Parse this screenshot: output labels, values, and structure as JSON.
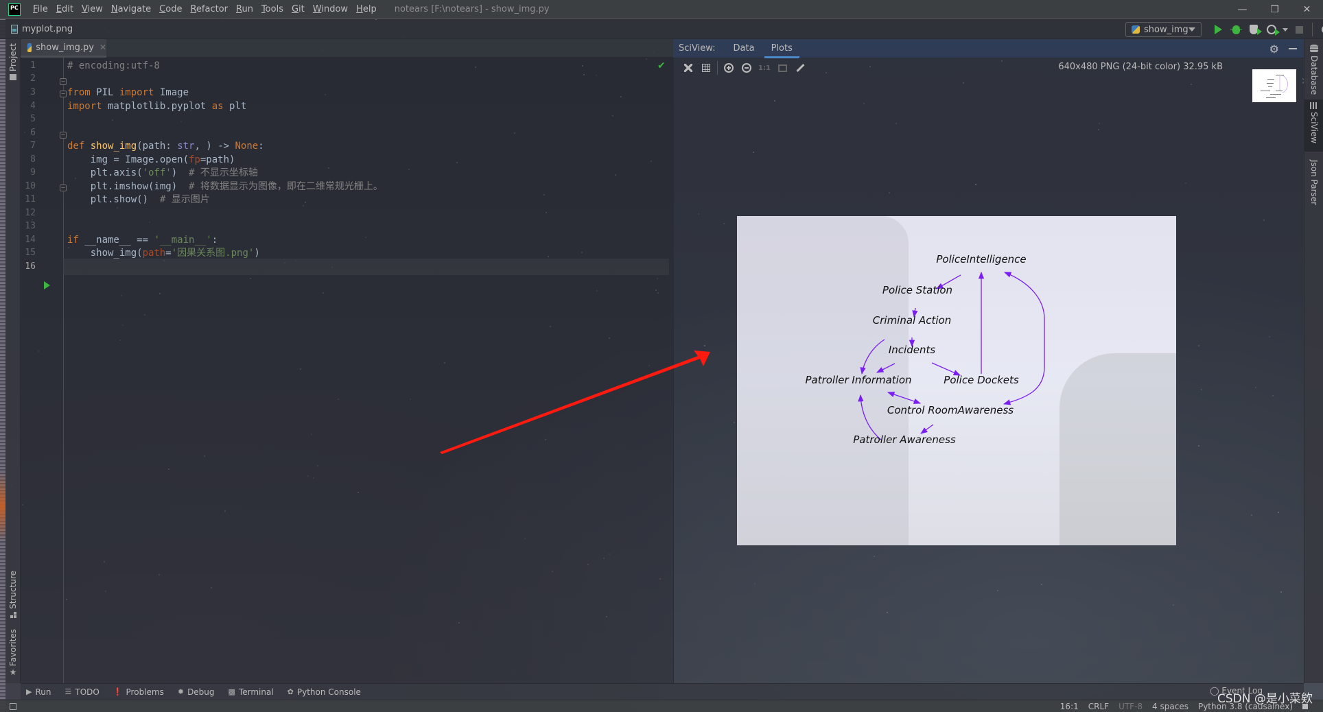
{
  "titlebar": {
    "menu": [
      "File",
      "Edit",
      "View",
      "Navigate",
      "Code",
      "Refactor",
      "Run",
      "Tools",
      "Git",
      "Window",
      "Help"
    ],
    "window_title": "notears [F:\\notears] - show_img.py",
    "logo": "PC"
  },
  "navbar": {
    "breadcrumb": "myplot.png",
    "run_config": "show_img"
  },
  "left_stripe": {
    "project": "Project",
    "structure": "Structure",
    "favorites": "Favorites"
  },
  "editor": {
    "tab": "show_img.py",
    "current_line": 16,
    "line_numbers": [
      "1",
      "2",
      "3",
      "4",
      "5",
      "6",
      "7",
      "8",
      "9",
      "10",
      "11",
      "12",
      "13",
      "14",
      "15",
      "16"
    ],
    "lines": {
      "l1": {
        "cm": "# encoding:utf-8"
      },
      "l3": {
        "kw1": "from",
        "t1": " PIL ",
        "kw2": "import",
        "t2": " Image"
      },
      "l4": {
        "kw1": "import",
        "t1": " matplotlib.pyplot ",
        "kw2": "as",
        "t2": " plt"
      },
      "l7": {
        "kw": "def",
        "sp": " ",
        "fn": "show_img",
        "t1": "(path: ",
        "bi": "str",
        "t2": ", ) -> ",
        "kw2": "None",
        "t3": ":"
      },
      "l8": {
        "t1": "    img = Image.open(",
        "param": "fp",
        "t2": "=path)"
      },
      "l9": {
        "t1": "    plt.axis(",
        "str": "'off'",
        "t2": ")  ",
        "cm": "# 不显示坐标轴"
      },
      "l10": {
        "t1": "    plt.imshow(img)  ",
        "cm": "# 将数据显示为图像，即在二维常规光栅上。"
      },
      "l11": {
        "t1": "    plt.show()  ",
        "cm": "# 显示图片"
      },
      "l14": {
        "kw": "if",
        "t1": " __name__ == ",
        "str": "'__main__'",
        "t2": ":"
      },
      "l15": {
        "t1": "    show_img(",
        "param": "path",
        "t2": "=",
        "str": "'因果关系图.png'",
        "t3": ")"
      }
    }
  },
  "sciview": {
    "title": "SciView:",
    "tabs": [
      {
        "label": "Data",
        "active": false
      },
      {
        "label": "Plots",
        "active": true
      }
    ],
    "image_info": "640x480 PNG (24-bit color) 32.95 kB",
    "ratio_label": "1:1"
  },
  "plot": {
    "nodes": [
      {
        "id": "police_intelligence",
        "label": "PoliceIntelligence"
      },
      {
        "id": "police_station",
        "label": "Police Station"
      },
      {
        "id": "criminal_action",
        "label": "Criminal Action"
      },
      {
        "id": "incidents",
        "label": "Incidents"
      },
      {
        "id": "patroller_information",
        "label": "Patroller Information"
      },
      {
        "id": "police_dockets",
        "label": "Police Dockets"
      },
      {
        "id": "control_room_awareness",
        "label": "Control RoomAwareness"
      },
      {
        "id": "patroller_awareness",
        "label": "Patroller Awareness"
      }
    ],
    "edges": [
      {
        "from": "police_intelligence",
        "to": "police_station"
      },
      {
        "from": "police_station",
        "to": "criminal_action"
      },
      {
        "from": "criminal_action",
        "to": "incidents"
      },
      {
        "from": "criminal_action",
        "to": "patroller_information"
      },
      {
        "from": "incidents",
        "to": "patroller_information"
      },
      {
        "from": "incidents",
        "to": "police_dockets"
      },
      {
        "from": "police_dockets",
        "to": "police_intelligence"
      },
      {
        "from": "control_room_awareness",
        "to": "police_intelligence",
        "bidirectional": true
      },
      {
        "from": "patroller_information",
        "to": "control_room_awareness",
        "bidirectional": true
      },
      {
        "from": "control_room_awareness",
        "to": "patroller_awareness"
      },
      {
        "from": "patroller_awareness",
        "to": "patroller_information"
      }
    ],
    "edge_color": "#7a1ff0"
  },
  "right_stripe": {
    "tabs": [
      {
        "label": "Database",
        "active": false
      },
      {
        "label": "SciView",
        "active": true
      },
      {
        "label": "Json Parser",
        "active": false
      }
    ]
  },
  "bottom_tools": [
    "Run",
    "TODO",
    "Problems",
    "Debug",
    "Terminal",
    "Python Console"
  ],
  "event_log": "Event Log",
  "status": {
    "position": "16:1",
    "line_sep": "CRLF",
    "encoding": "UTF-8",
    "indent": "4 spaces",
    "interpreter": "Python 3.8 (causalnex)"
  },
  "watermark": "CSDN @是小菜欸",
  "annotation_color": "#ff1a10"
}
